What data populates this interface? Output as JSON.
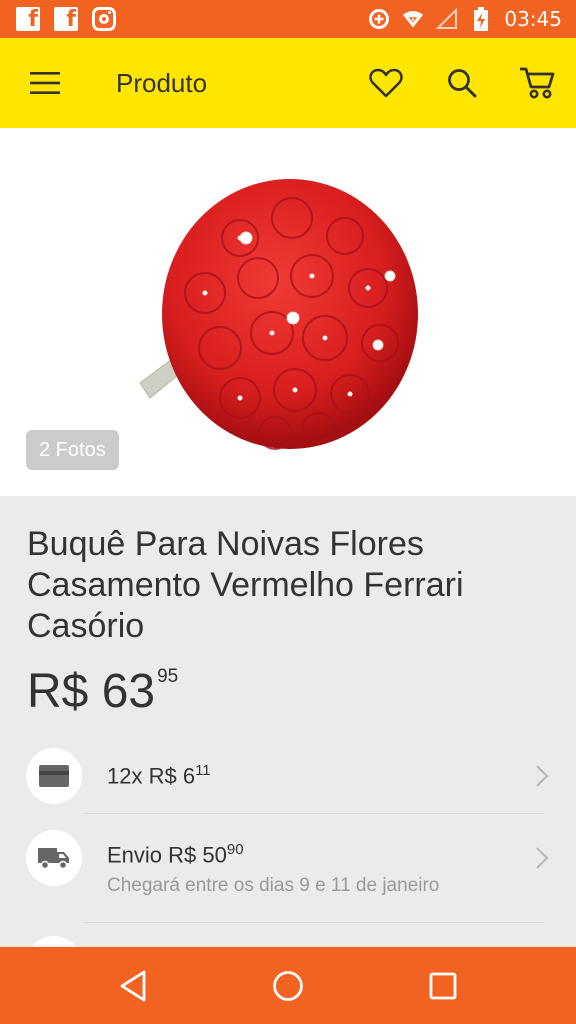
{
  "status_bar": {
    "time": "03:45",
    "left_icons": [
      "facebook-icon",
      "facebook-icon",
      "instagram-icon"
    ],
    "right_icons": [
      "data-saver-icon",
      "wifi-icon",
      "signal-icon",
      "battery-charging-icon"
    ],
    "color": "#f26322"
  },
  "app_bar": {
    "title": "Produto",
    "color": "#ffe600",
    "icons": [
      "menu-icon",
      "heart-icon",
      "search-icon",
      "cart-icon"
    ]
  },
  "gallery": {
    "photo_count_label": "2 Fotos"
  },
  "product": {
    "title": "Buquê Para Noivas Flores Casamento Vermelho Ferrari Casório",
    "price_main": "R$ 63",
    "price_cents": "95"
  },
  "installments": {
    "label": "12x R$ 6",
    "cents": "11",
    "icon": "credit-card-icon"
  },
  "shipping": {
    "label": "Envio R$ 50",
    "cents": "90",
    "arrival": "Chegará entre os dias 9 e 11 de janeiro",
    "icon": "truck-icon"
  },
  "nav_bar": {
    "color": "#f26322",
    "icons": [
      "back-icon",
      "home-icon",
      "recents-icon"
    ]
  }
}
